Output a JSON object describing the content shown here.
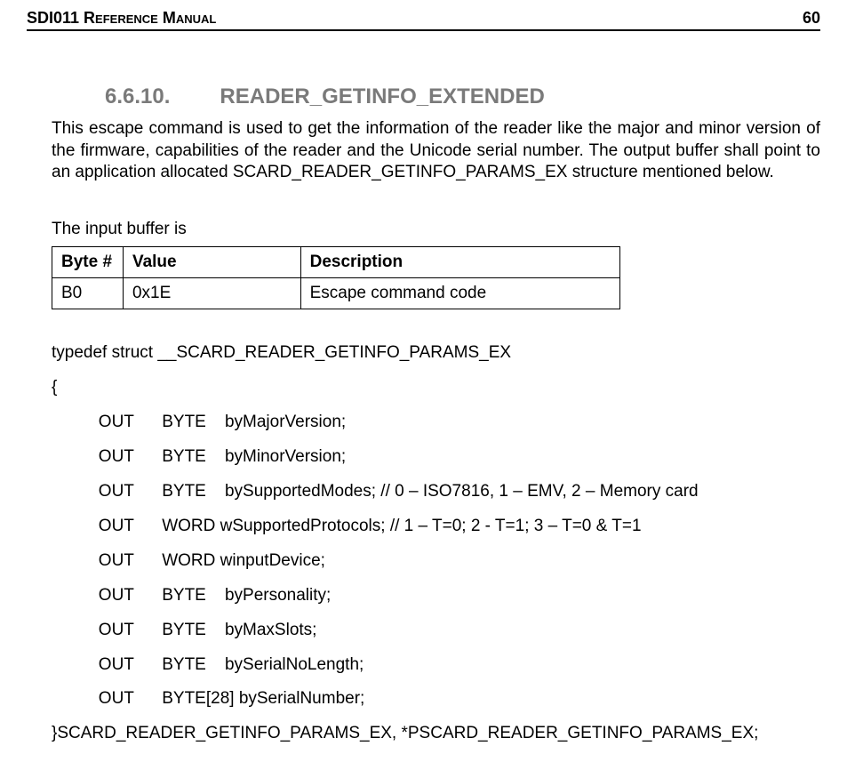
{
  "header": {
    "title": "SDI011 Reference Manual",
    "page": "60"
  },
  "section": {
    "number": "6.6.10.",
    "name": "READER_GETINFO_EXTENDED"
  },
  "paragraph": "This escape command is used to get the information of the reader like the major and minor version of the firmware, capabilities of the reader and the Unicode serial number. The output buffer shall point to an application allocated SCARD_READER_GETINFO_PARAMS_EX structure mentioned below.",
  "input_label": "The input buffer is",
  "table": {
    "headers": {
      "byte": "Byte #",
      "value": "Value",
      "desc": "Description"
    },
    "rows": [
      {
        "byte": "B0",
        "value": "0x1E",
        "desc": "Escape command code"
      }
    ]
  },
  "struct": {
    "typedef_line": "typedef struct __SCARD_READER_GETINFO_PARAMS_EX",
    "open": "{",
    "members": [
      "          OUT      BYTE    byMajorVersion;",
      "          OUT      BYTE    byMinorVersion;",
      "          OUT      BYTE    bySupportedModes; // 0 – ISO7816, 1 – EMV, 2 – Memory card",
      "          OUT      WORD wSupportedProtocols; // 1 – T=0; 2 - T=1; 3 – T=0 & T=1",
      "          OUT      WORD winputDevice;",
      "          OUT      BYTE    byPersonality;",
      "          OUT      BYTE    byMaxSlots;",
      "          OUT      BYTE    bySerialNoLength;",
      "          OUT      BYTE[28] bySerialNumber;"
    ],
    "close": "}SCARD_READER_GETINFO_PARAMS_EX, *PSCARD_READER_GETINFO_PARAMS_EX;"
  }
}
